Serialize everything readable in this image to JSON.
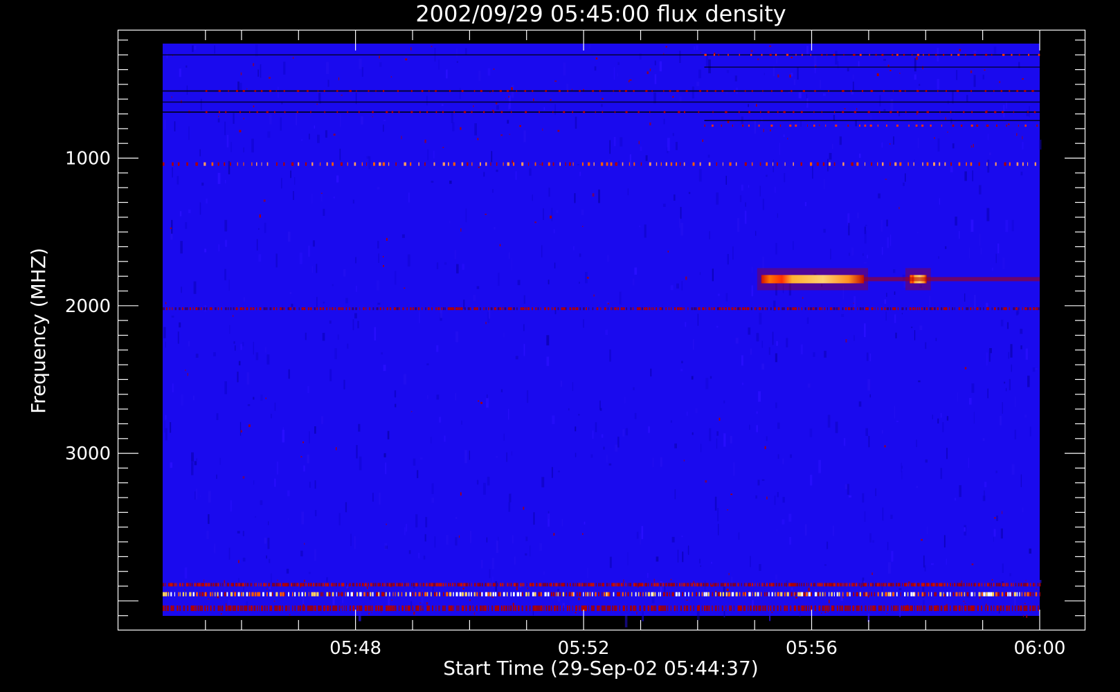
{
  "chart_data": {
    "type": "heatmap",
    "title": "2002/09/29 05:45:00 flux density",
    "xlabel": "Start Time (29-Sep-02 05:44:37)",
    "ylabel": "Frequency (MHZ)",
    "x_tick_labels": [
      "05:48",
      "05:52",
      "05:56",
      "06:00"
    ],
    "x_tick_values_min": [
      3.383,
      7.383,
      11.383,
      15.383
    ],
    "x_range_min": [
      0,
      15.383
    ],
    "y_tick_labels": [
      "1000",
      "2000",
      "3000"
    ],
    "y_tick_values": [
      1000,
      2000,
      3000
    ],
    "ylim": [
      4200,
      130
    ],
    "data_extent": {
      "x_min": [
        0.75,
        15.383
      ],
      "y_mhz": [
        230,
        4100
      ]
    },
    "colors": {
      "background": "#000000",
      "axes": "#ffffff",
      "base_spectrum": "#1a0aee",
      "low_intensity": "#b00000",
      "mid_intensity": "#ff5a00",
      "high_intensity": "#ffd060"
    },
    "features": [
      {
        "name": "Radio burst",
        "freq_mhz": 1820,
        "time_min": [
          10.5,
          12.3
        ],
        "intensity": "high"
      },
      {
        "name": "Radio burst",
        "freq_mhz": 1820,
        "time_min": [
          13.1,
          13.4
        ],
        "intensity": "high"
      },
      {
        "name": "Interference band",
        "freq_mhz": 1040,
        "intensity": "medium"
      },
      {
        "name": "Interference band",
        "freq_mhz": 2020,
        "intensity": "medium"
      },
      {
        "name": "Interference band",
        "freq_mhz": 3950,
        "intensity": "high"
      }
    ]
  }
}
